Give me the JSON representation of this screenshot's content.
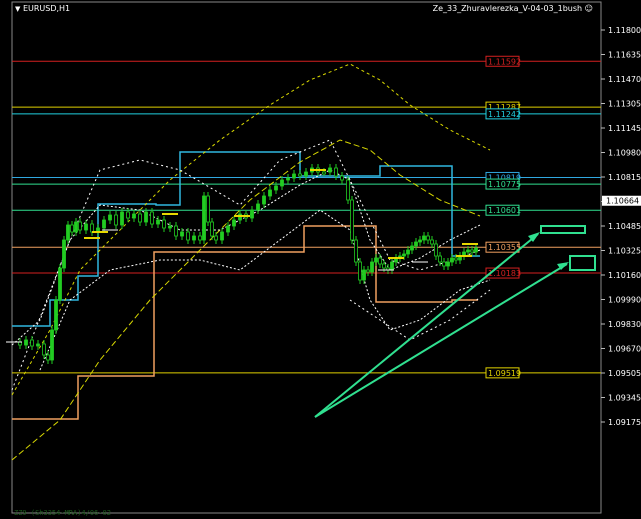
{
  "header": {
    "symbol": "EURUSD,H1",
    "indicator": "Ze_33_Zhuravlerezka_V-04-03_1bush"
  },
  "price_axis": {
    "labels": [
      "1.11800",
      "1.11635",
      "1.11470",
      "1.11305",
      "1.11145",
      "1.10980",
      "1.10815",
      "1.10650",
      "1.10485",
      "1.10325",
      "1.10160",
      "1.09990",
      "1.09830",
      "1.09670",
      "1.09505",
      "1.09345",
      "1.09175"
    ],
    "current_price": "1.10664"
  },
  "levels": [
    {
      "label": "1.11592",
      "color": "#d32020",
      "price": 1.11592
    },
    {
      "label": "1.11287",
      "color": "#e0d000",
      "price": 1.11287
    },
    {
      "label": "1.11242",
      "color": "#20d0e0",
      "price": 1.11242
    },
    {
      "label": "1.10819",
      "color": "#30a8e0",
      "price": 1.10819
    },
    {
      "label": "1.10775",
      "color": "#30e090",
      "price": 1.10775
    },
    {
      "label": "1.10601",
      "color": "#30e090",
      "price": 1.10601
    },
    {
      "label": "1.10355",
      "color": "#f0a060",
      "price": 1.10355
    },
    {
      "label": "1.10183",
      "color": "#d32020",
      "price": 1.10183
    },
    {
      "label": "1.09519",
      "color": "#e0d000",
      "price": 1.09519
    }
  ],
  "annotations": {
    "arrow_color": "#30e090"
  },
  "footer": {
    "text": "ZZ9 (Sh3354-MRA)4/06-02"
  }
}
